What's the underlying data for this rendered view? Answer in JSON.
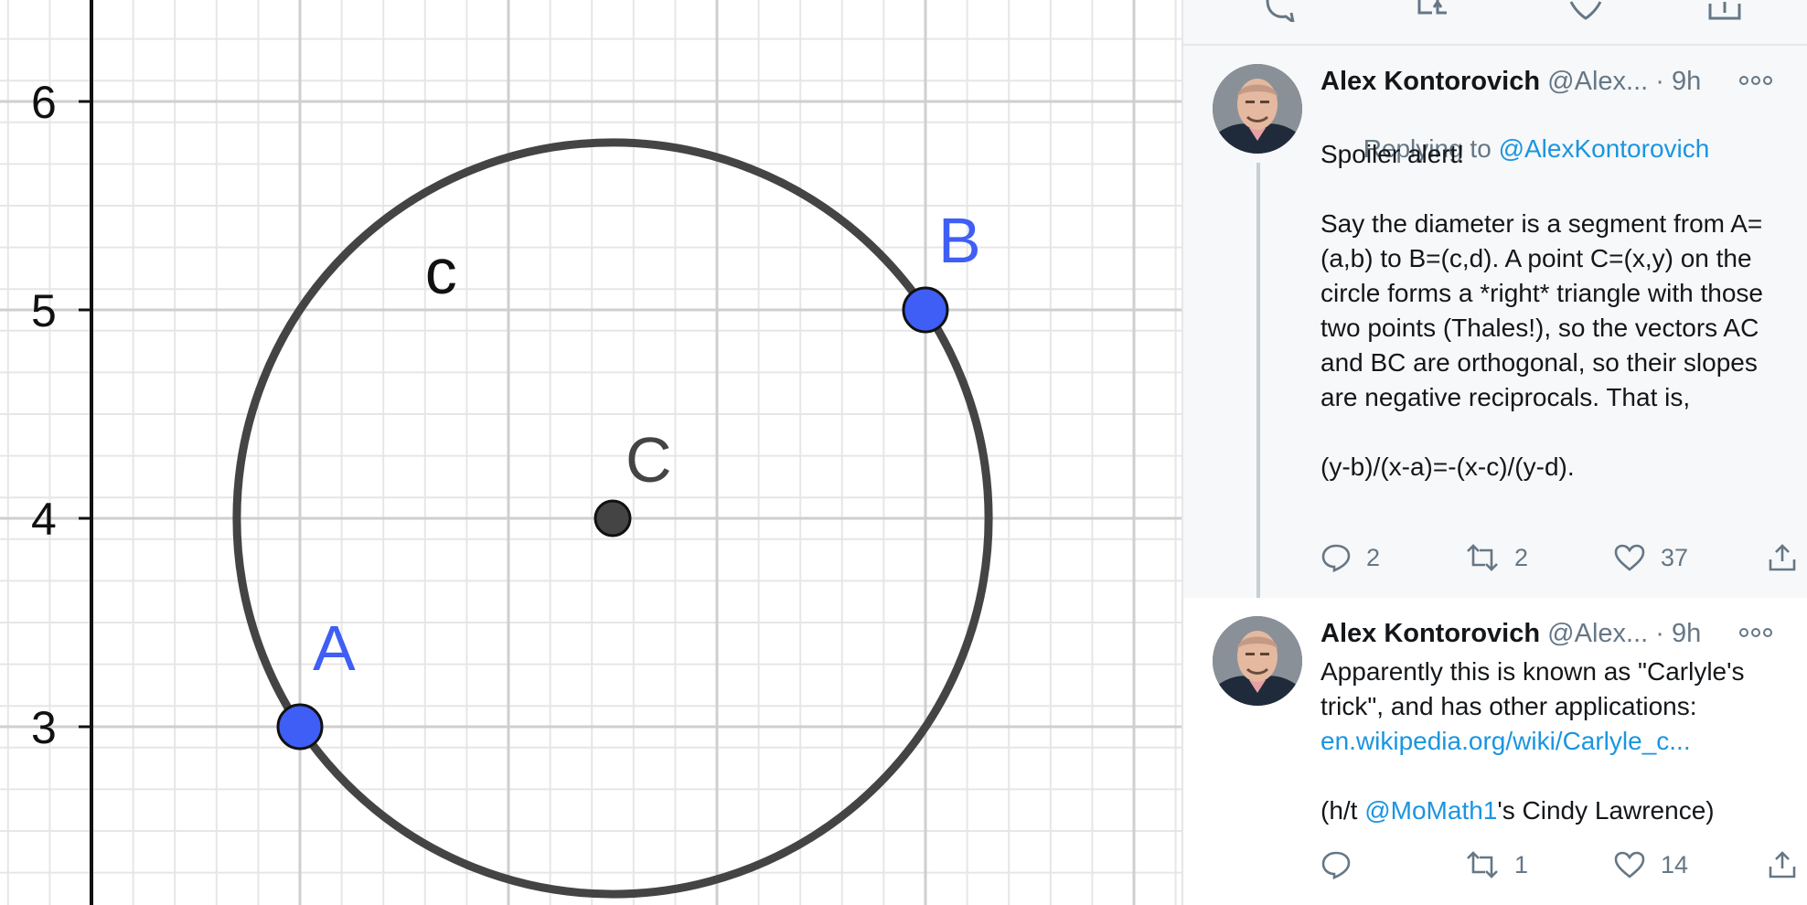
{
  "canvas": {
    "x_ticks": [],
    "y_ticks": [
      "6",
      "5",
      "4",
      "3"
    ],
    "points": [
      {
        "name": "A",
        "label": "A",
        "x": 1,
        "y": 3,
        "color": "#3f5ef5"
      },
      {
        "name": "B",
        "label": "B",
        "x": 4,
        "y": 5,
        "color": "#3f5ef5"
      },
      {
        "name": "C",
        "label": "C",
        "x": 2.5,
        "y": 4,
        "color": "#444444"
      }
    ],
    "circle": {
      "label": "c",
      "cx": 2.5,
      "cy": 4,
      "r": 1.803,
      "color": "#444444"
    },
    "colors": {
      "grid_major": "#cfcfcf",
      "grid_minor": "#e6e6e6",
      "axis": "#111111",
      "point_blue": "#3f5ef5",
      "point_gray": "#444444"
    }
  },
  "thread": {
    "colors": {
      "text": "#14171a",
      "muted": "#657786",
      "link": "#1b95e0",
      "bg": "#f7f8f9"
    },
    "tweets": [
      {
        "name": "Alex Kontorovich",
        "handle": "@Alex...",
        "time": "· 9h",
        "replying_prefix": "Replying to ",
        "replying_to": "@AlexKontorovich",
        "body": "Spoiler alert!\n\nSay the diameter is a segment from A=(a,b) to B=(c,d). A point C=(x,y) on the circle forms a *right* triangle with those two points (Thales!), so the vectors AC and BC are orthogonal, so their slopes are negative reciprocals. That is,\n\n(y-b)/(x-a)=-(x-c)/(y-d).",
        "replies": "2",
        "retweets": "2",
        "likes": "37"
      },
      {
        "name": "Alex Kontorovich",
        "handle": "@Alex...",
        "time": "· 9h",
        "body_part1": "Apparently this is known as \"Carlyle's trick\", and has other applications:",
        "link": "en.wikipedia.org/wiki/Carlyle_c...",
        "body_part2_prefix": "(h/t ",
        "mention": "@MoMath1",
        "body_part2_suffix": "'s Cindy Lawrence)",
        "replies": "",
        "retweets": "1",
        "likes": "14"
      }
    ]
  }
}
